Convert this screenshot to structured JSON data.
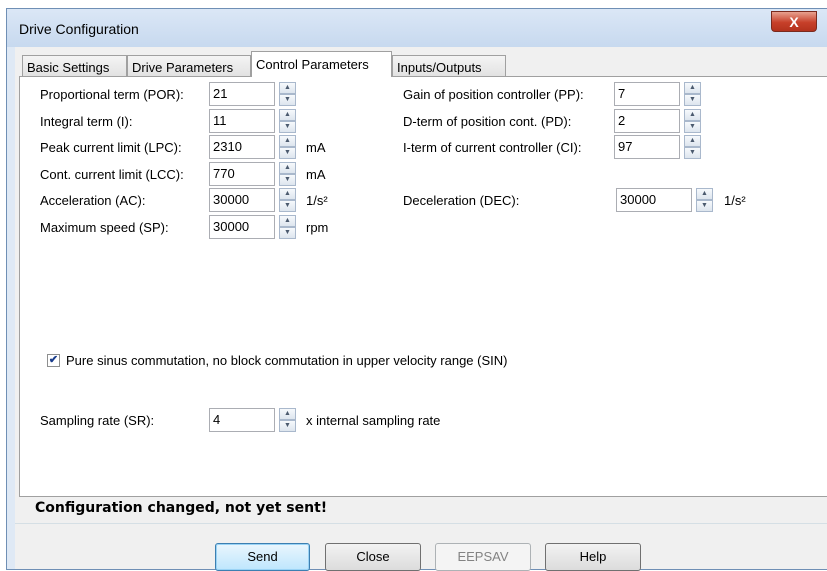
{
  "window": {
    "title": "Drive Configuration",
    "close_glyph": "X"
  },
  "tabs": [
    {
      "label": "Basic Settings",
      "active": false
    },
    {
      "label": "Drive Parameters",
      "active": false
    },
    {
      "label": "Control Parameters",
      "active": true
    },
    {
      "label": "Inputs/Outputs",
      "active": false
    }
  ],
  "left_params": [
    {
      "label": "Proportional term (POR):",
      "value": "21",
      "unit": ""
    },
    {
      "label": "Integral term (I):",
      "value": "11",
      "unit": ""
    },
    {
      "label": "Peak current limit (LPC):",
      "value": "2310",
      "unit": "mA"
    },
    {
      "label": "Cont. current limit (LCC):",
      "value": "770",
      "unit": "mA"
    },
    {
      "label": "Acceleration (AC):",
      "value": "30000",
      "unit": "1/s²"
    },
    {
      "label": "Maximum speed (SP):",
      "value": "30000",
      "unit": "rpm"
    }
  ],
  "right_params": [
    {
      "label": "Gain of position controller (PP):",
      "value": "7",
      "unit": ""
    },
    {
      "label": "D-term of position cont. (PD):",
      "value": "2",
      "unit": ""
    },
    {
      "label": "I-term of current controller (CI):",
      "value": "97",
      "unit": ""
    },
    {
      "label": "Deceleration (DEC):",
      "value": "30000",
      "unit": "1/s²"
    }
  ],
  "sin_checkbox": {
    "label": "Pure sinus commutation, no block commutation in upper velocity range (SIN)",
    "checked": true,
    "glyph": "✔"
  },
  "sampling": {
    "label": "Sampling rate (SR):",
    "value": "4",
    "unit": "x internal sampling rate"
  },
  "spinner": {
    "up_glyph": "▲",
    "down_glyph": "▼"
  },
  "status_text": "Configuration changed, not yet sent!",
  "buttons": {
    "send": "Send",
    "close": "Close",
    "eepsav": "EEPSAV",
    "help": "Help"
  },
  "colors": {
    "title_bar": "#c7d9ef",
    "close_button": "#c7402a",
    "panel": "#ffffff",
    "default_button": "#bee6fd"
  }
}
